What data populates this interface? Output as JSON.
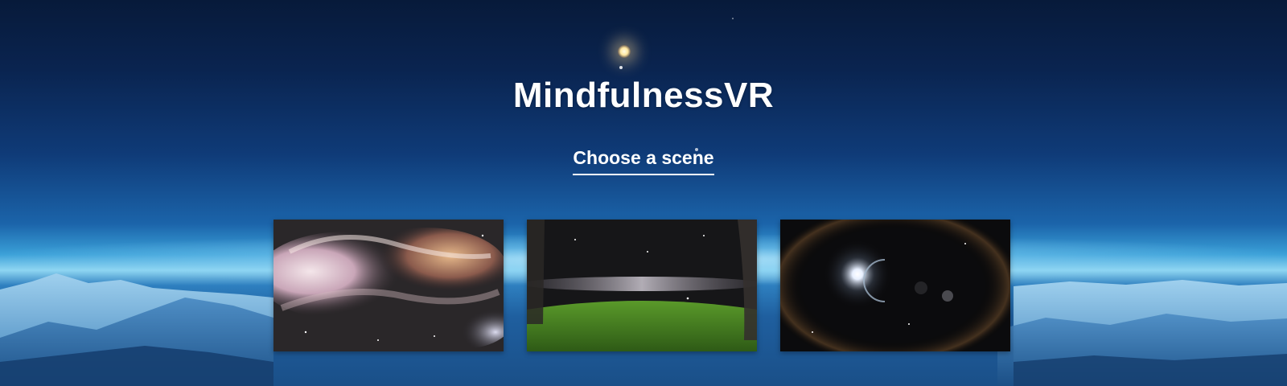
{
  "app": {
    "title": "MindfulnessVR",
    "subtitle": "Choose a scene"
  },
  "scenes": [
    {
      "name": "nebula",
      "thumbnail": "nebula clouds"
    },
    {
      "name": "milky-way-meadow",
      "thumbnail": "milky way over grass field"
    },
    {
      "name": "space-planet",
      "thumbnail": "bright star and planet in space"
    }
  ],
  "colors": {
    "sky_top": "#071a3a",
    "sky_mid": "#0f3b78",
    "horizon": "#8fd6f2",
    "text": "#ffffff"
  }
}
